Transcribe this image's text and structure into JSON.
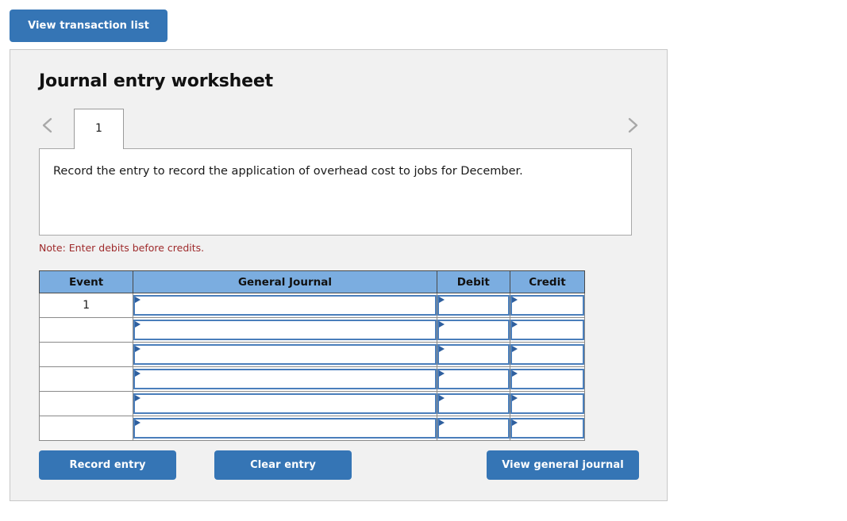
{
  "top_bar": {
    "view_transaction_list_label": "View transaction list"
  },
  "panel": {
    "title": "Journal entry worksheet",
    "pager": {
      "prev_icon": "chevron-left-icon",
      "next_icon": "chevron-right-icon",
      "tabs": [
        {
          "label": "1",
          "active": true
        }
      ]
    },
    "description": "Record the entry to record the application of overhead cost to jobs for December.",
    "note": "Note: Enter debits before credits.",
    "table": {
      "headers": [
        "Event",
        "General Journal",
        "Debit",
        "Credit"
      ],
      "rows": [
        {
          "event": "1",
          "general_journal": "",
          "debit": "",
          "credit": ""
        },
        {
          "event": "",
          "general_journal": "",
          "debit": "",
          "credit": ""
        },
        {
          "event": "",
          "general_journal": "",
          "debit": "",
          "credit": ""
        },
        {
          "event": "",
          "general_journal": "",
          "debit": "",
          "credit": ""
        },
        {
          "event": "",
          "general_journal": "",
          "debit": "",
          "credit": ""
        },
        {
          "event": "",
          "general_journal": "",
          "debit": "",
          "credit": ""
        }
      ]
    },
    "actions": {
      "record_entry_label": "Record entry",
      "clear_entry_label": "Clear entry",
      "view_general_journal_label": "View general journal"
    }
  },
  "colors": {
    "button_blue": "#3575b5",
    "table_header_blue": "#7bade0",
    "input_border_blue": "#4a7ebb",
    "note_red": "#9e2a2b",
    "panel_bg": "#f1f1f1"
  }
}
